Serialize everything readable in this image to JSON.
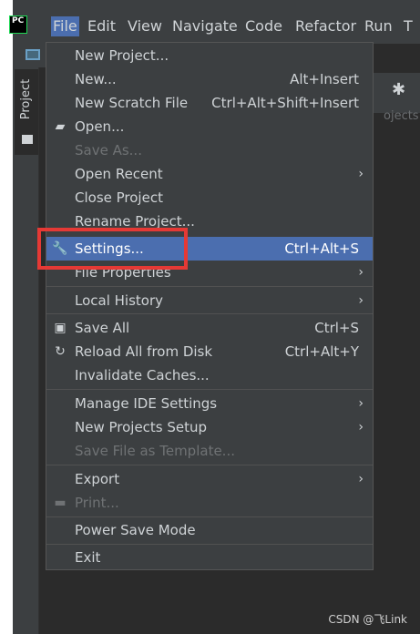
{
  "logo_text": "PC",
  "menubar": [
    "File",
    "Edit",
    "View",
    "Navigate",
    "Code",
    "Refactor",
    "Run",
    "T"
  ],
  "project_tab": "Project",
  "projects_fragment": "ojects",
  "menu": {
    "new_project": "New Project...",
    "new": "New...",
    "new_shortcut": "Alt+Insert",
    "new_scratch": "New Scratch File",
    "new_scratch_shortcut": "Ctrl+Alt+Shift+Insert",
    "open": "Open...",
    "save_as": "Save As...",
    "open_recent": "Open Recent",
    "close_project": "Close Project",
    "rename_project": "Rename Project...",
    "settings": "Settings...",
    "settings_shortcut": "Ctrl+Alt+S",
    "file_properties": "File Properties",
    "local_history": "Local History",
    "save_all": "Save All",
    "save_all_shortcut": "Ctrl+S",
    "reload": "Reload All from Disk",
    "reload_shortcut": "Ctrl+Alt+Y",
    "invalidate": "Invalidate Caches...",
    "manage_ide": "Manage IDE Settings",
    "new_projects_setup": "New Projects Setup",
    "save_template": "Save File as Template...",
    "export": "Export",
    "print": "Print...",
    "power_save": "Power Save Mode",
    "exit": "Exit"
  },
  "watermark": "CSDN @飞Link",
  "colors": {
    "background": "#3c3f41",
    "selection": "#4b6eaf",
    "highlight": "#e53935"
  }
}
